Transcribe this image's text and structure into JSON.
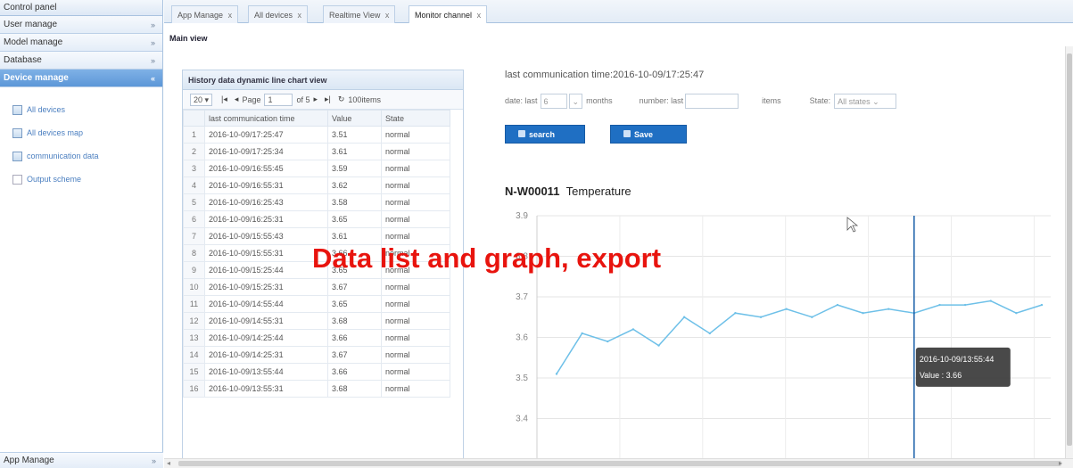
{
  "sidebar": {
    "title": "Control panel",
    "sections": [
      {
        "label": "User manage",
        "chevron": "»"
      },
      {
        "label": "Model manage",
        "chevron": "»"
      },
      {
        "label": "Database",
        "chevron": "»"
      },
      {
        "label": "Device manage",
        "chevron": "«"
      }
    ],
    "items": [
      {
        "label": "All devices",
        "icon": "table-icon"
      },
      {
        "label": "All devices map",
        "icon": "table-icon"
      },
      {
        "label": "communication data",
        "icon": "table-icon"
      },
      {
        "label": "Output scheme",
        "icon": "document-icon"
      }
    ],
    "bottom": {
      "label": "App Manage",
      "chevron": "»"
    }
  },
  "tabs": [
    {
      "label": "App Manage",
      "close": "x"
    },
    {
      "label": "All devices",
      "close": "x"
    },
    {
      "label": "Realtime View",
      "close": "x"
    },
    {
      "label": "Monitor channel",
      "close": "x"
    }
  ],
  "main_title": "Main view",
  "grid": {
    "title": "History data dynamic line chart view",
    "page_size": "20",
    "page_label": "Page",
    "page_value": "1",
    "of_pages": "of 5",
    "items_label": "100items",
    "columns": [
      "last communication time",
      "Value",
      "State"
    ],
    "rows": [
      {
        "n": "1",
        "time": "2016-10-09/17:25:47",
        "value": "3.51",
        "state": "normal"
      },
      {
        "n": "2",
        "time": "2016-10-09/17:25:34",
        "value": "3.61",
        "state": "normal"
      },
      {
        "n": "3",
        "time": "2016-10-09/16:55:45",
        "value": "3.59",
        "state": "normal"
      },
      {
        "n": "4",
        "time": "2016-10-09/16:55:31",
        "value": "3.62",
        "state": "normal"
      },
      {
        "n": "5",
        "time": "2016-10-09/16:25:43",
        "value": "3.58",
        "state": "normal"
      },
      {
        "n": "6",
        "time": "2016-10-09/16:25:31",
        "value": "3.65",
        "state": "normal"
      },
      {
        "n": "7",
        "time": "2016-10-09/15:55:43",
        "value": "3.61",
        "state": "normal"
      },
      {
        "n": "8",
        "time": "2016-10-09/15:55:31",
        "value": "3.66",
        "state": "normal"
      },
      {
        "n": "9",
        "time": "2016-10-09/15:25:44",
        "value": "3.65",
        "state": "normal"
      },
      {
        "n": "10",
        "time": "2016-10-09/15:25:31",
        "value": "3.67",
        "state": "normal"
      },
      {
        "n": "11",
        "time": "2016-10-09/14:55:44",
        "value": "3.65",
        "state": "normal"
      },
      {
        "n": "12",
        "time": "2016-10-09/14:55:31",
        "value": "3.68",
        "state": "normal"
      },
      {
        "n": "13",
        "time": "2016-10-09/14:25:44",
        "value": "3.66",
        "state": "normal"
      },
      {
        "n": "14",
        "time": "2016-10-09/14:25:31",
        "value": "3.67",
        "state": "normal"
      },
      {
        "n": "15",
        "time": "2016-10-09/13:55:44",
        "value": "3.66",
        "state": "normal"
      },
      {
        "n": "16",
        "time": "2016-10-09/13:55:31",
        "value": "3.68",
        "state": "normal"
      }
    ]
  },
  "right": {
    "last_comm": "last communication time:2016-10-09/17:25:47",
    "date_label": "date: last",
    "date_value": "6",
    "months_label": "months",
    "number_label": "number: last",
    "number_value": "",
    "items_label": "items",
    "state_label": "State:",
    "state_value": "All states",
    "search_label": "search",
    "save_label": "Save",
    "chart_device": "N-W00011",
    "chart_name": "Temperature"
  },
  "overlay_text": "Data list and graph, export",
  "tooltip": {
    "time": "2016-10-09/13:55:44",
    "value": "Value : 3.66"
  },
  "colors": {
    "accent": "#1f6fc3",
    "line": "#6ec0e8",
    "marker": "#1a5fa8",
    "overlay": "#e8140e"
  },
  "chart_data": {
    "type": "line",
    "title": "N-W00011 Temperature",
    "ylim": [
      3.3,
      3.9
    ],
    "yticks": [
      "3.9",
      "3.8",
      "3.7",
      "3.6",
      "3.5",
      "3.4"
    ],
    "series": [
      {
        "values": [
          3.51,
          3.61,
          3.59,
          3.62,
          3.58,
          3.65,
          3.61,
          3.66,
          3.65,
          3.67,
          3.65,
          3.68,
          3.66,
          3.67,
          3.66,
          3.68,
          3.68,
          3.69,
          3.66,
          3.68
        ]
      }
    ],
    "highlight_index": 14,
    "grid": true
  }
}
